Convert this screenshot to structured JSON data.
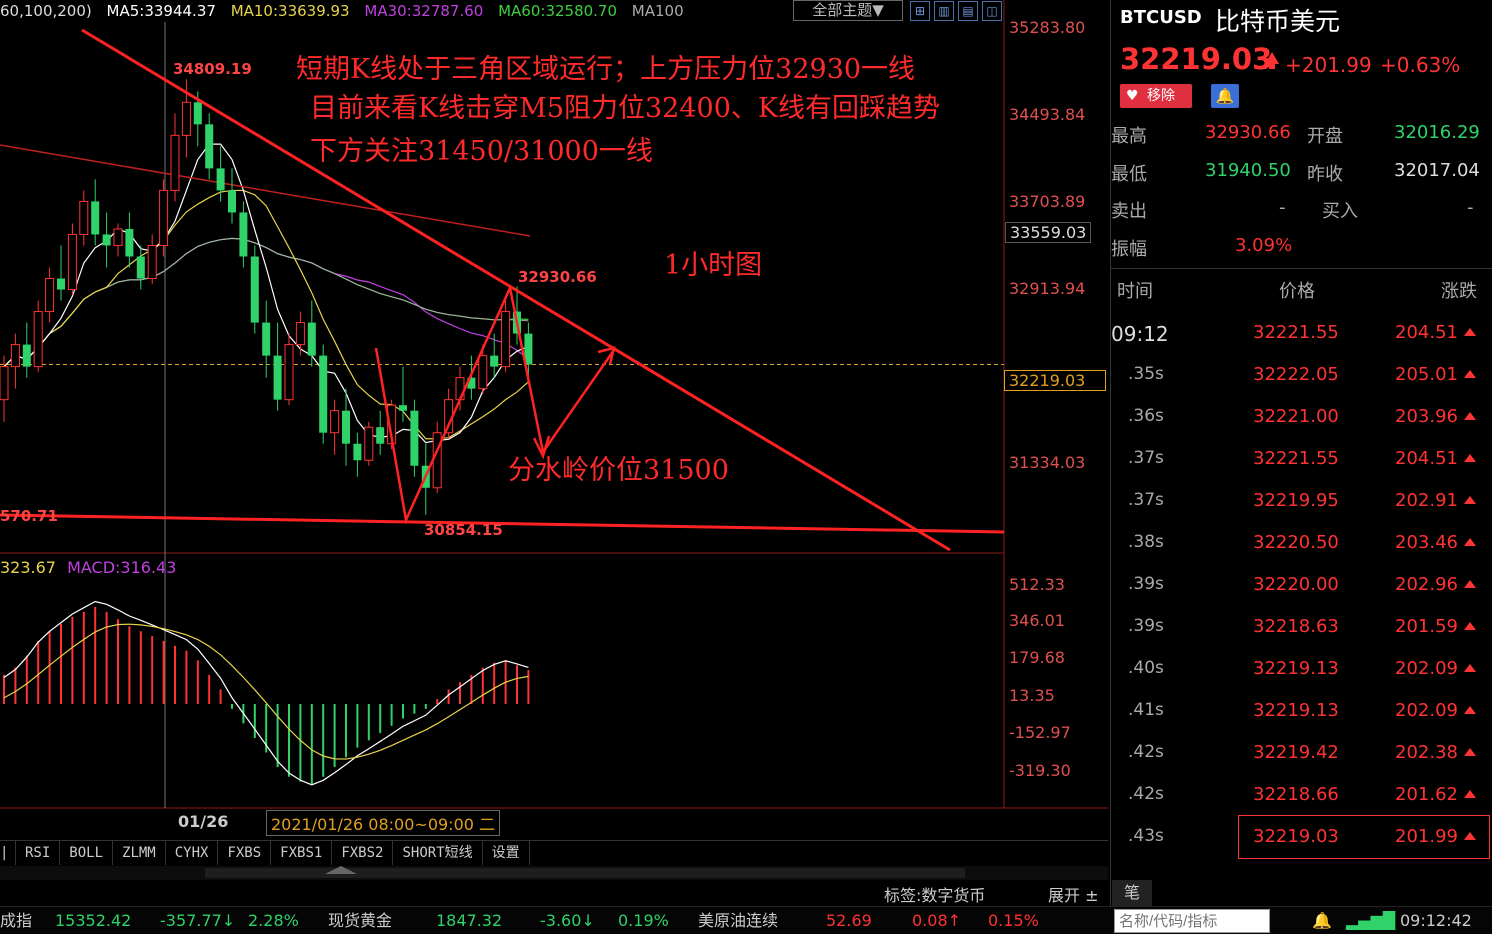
{
  "ma_header": {
    "prefix": "60,100,200)",
    "ma5": "MA5:33944.37",
    "ma10": "MA10:33639.93",
    "ma30": "MA30:32787.60",
    "ma60": "MA60:32580.70",
    "ma100": "MA100",
    "theme_button": "全部主题▼"
  },
  "price_axis": [
    "35283.80",
    "34493.84",
    "33703.89",
    "33559.03",
    "32913.94",
    "32219.03",
    "31334.03"
  ],
  "macd_axis": [
    "512.33",
    "346.01",
    "179.68",
    "13.35",
    "-152.97",
    "-319.30"
  ],
  "annotations": {
    "line1": "短期K线处于三角区域运行；上方压力位32930一线",
    "line2": "目前来看K线击穿M5阻力位32400、K线有回踩趋势",
    "line3": "下方关注31450/31000一线",
    "timeframe": "1小时图",
    "watershed": "分水岭价位31500"
  },
  "point_labels": {
    "high": "34809.19",
    "mid_high": "32930.66",
    "low": "30854.15",
    "left_cut": "570.71"
  },
  "macd_header": {
    "dif": "323.67",
    "macd": "MACD:316.43"
  },
  "time_axis": {
    "date": "01/26",
    "range": "2021/01/26 08:00~09:00 二"
  },
  "bottom_tabs": [
    "RSI",
    "BOLL",
    "ZLMM",
    "CYHX",
    "FXBS",
    "FXBS1",
    "FXBS2",
    "SHORT短线",
    "设置"
  ],
  "tag_bar": {
    "tag": "标签:数字货币",
    "expand": "展开 ±",
    "pen": "笔"
  },
  "ticker": {
    "label1": "成指",
    "v1": "15352.42",
    "c1": "-357.77↓",
    "p1": "2.28%",
    "label2": "现货黄金",
    "v2": "1847.32",
    "c2": "-3.60↓",
    "p2": "0.19%",
    "label3": "美原油连续",
    "v3": "52.69",
    "c3": "0.08↑",
    "p3": "0.15%",
    "search_placeholder": "名称/代码/指标",
    "clock": "09:12:42"
  },
  "quote": {
    "symbol": "BTCUSD",
    "name": "比特币美元",
    "price": "32219.03",
    "change": "+201.99",
    "change_pct": "+0.63%",
    "remove_btn": "移除",
    "high_label": "最高",
    "high": "32930.66",
    "open_label": "开盘",
    "open": "32016.29",
    "low_label": "最低",
    "low": "31940.50",
    "prev_label": "昨收",
    "prev": "32017.04",
    "sell_label": "卖出",
    "sell": "-",
    "buy_label": "买入",
    "buy": "-",
    "amp_label": "振幅",
    "amp": "3.09%"
  },
  "trades_header": {
    "time": "时间",
    "price": "价格",
    "change": "涨跌"
  },
  "trades": [
    {
      "time": "09:12",
      "price": "32221.55",
      "change": "204.51"
    },
    {
      "time": ".35s",
      "price": "32222.05",
      "change": "205.01"
    },
    {
      "time": ".36s",
      "price": "32221.00",
      "change": "203.96"
    },
    {
      "time": ".37s",
      "price": "32221.55",
      "change": "204.51"
    },
    {
      "time": ".37s",
      "price": "32219.95",
      "change": "202.91"
    },
    {
      "time": ".38s",
      "price": "32220.50",
      "change": "203.46"
    },
    {
      "time": ".39s",
      "price": "32220.00",
      "change": "202.96"
    },
    {
      "time": ".39s",
      "price": "32218.63",
      "change": "201.59"
    },
    {
      "time": ".40s",
      "price": "32219.13",
      "change": "202.09"
    },
    {
      "time": ".41s",
      "price": "32219.13",
      "change": "202.09"
    },
    {
      "time": ".42s",
      "price": "32219.42",
      "change": "202.38"
    },
    {
      "time": ".42s",
      "price": "32218.66",
      "change": "201.62"
    },
    {
      "time": ".43s",
      "price": "32219.03",
      "change": "201.99"
    }
  ],
  "colors": {
    "up": "#ff3333",
    "down": "#2fd36a",
    "annotation": "#ff2222",
    "ma5": "#ffffff",
    "ma10": "#e8d44a",
    "ma30": "#c040e0",
    "ma60": "#3fcf3f",
    "ma100": "#aaaaaa"
  },
  "candles": [
    [
      31900,
      32300,
      31700,
      32200
    ],
    [
      32200,
      32500,
      32000,
      32400
    ],
    [
      32400,
      32600,
      32100,
      32200
    ],
    [
      32200,
      32800,
      32150,
      32700
    ],
    [
      32700,
      33100,
      32600,
      33000
    ],
    [
      33000,
      33300,
      32800,
      32900
    ],
    [
      32900,
      33500,
      32850,
      33400
    ],
    [
      33400,
      33800,
      33300,
      33700
    ],
    [
      33700,
      33900,
      33300,
      33400
    ],
    [
      33400,
      33600,
      33100,
      33300
    ],
    [
      33300,
      33500,
      33200,
      33450
    ],
    [
      33450,
      33600,
      33100,
      33200
    ],
    [
      33200,
      33300,
      32900,
      33000
    ],
    [
      33000,
      33400,
      32950,
      33300
    ],
    [
      33300,
      33900,
      33200,
      33800
    ],
    [
      33800,
      34500,
      33700,
      34300
    ],
    [
      34300,
      34810,
      34100,
      34600
    ],
    [
      34600,
      34700,
      34200,
      34400
    ],
    [
      34400,
      34500,
      33900,
      34000
    ],
    [
      34000,
      34200,
      33700,
      33800
    ],
    [
      33800,
      34000,
      33500,
      33600
    ],
    [
      33600,
      33700,
      33100,
      33200
    ],
    [
      33200,
      33300,
      32500,
      32600
    ],
    [
      32600,
      32800,
      32100,
      32300
    ],
    [
      32300,
      32600,
      31800,
      31900
    ],
    [
      31900,
      32500,
      31850,
      32400
    ],
    [
      32400,
      32700,
      32300,
      32600
    ],
    [
      32600,
      32800,
      32200,
      32300
    ],
    [
      32300,
      32400,
      31500,
      31600
    ],
    [
      31600,
      31900,
      31400,
      31800
    ],
    [
      31800,
      32000,
      31300,
      31500
    ],
    [
      31500,
      31600,
      31200,
      31350
    ],
    [
      31350,
      31700,
      31300,
      31650
    ],
    [
      31650,
      31800,
      31400,
      31500
    ],
    [
      31500,
      31900,
      31450,
      31850
    ],
    [
      31850,
      32200,
      31700,
      31800
    ],
    [
      31800,
      31900,
      31200,
      31300
    ],
    [
      31300,
      31500,
      30854,
      31100
    ],
    [
      31100,
      31700,
      31050,
      31600
    ],
    [
      31600,
      32000,
      31550,
      31900
    ],
    [
      31900,
      32200,
      31800,
      32100
    ],
    [
      32100,
      32300,
      31900,
      32000
    ],
    [
      32000,
      32400,
      31950,
      32300
    ],
    [
      32300,
      32500,
      32100,
      32200
    ],
    [
      32200,
      32800,
      32150,
      32700
    ],
    [
      32700,
      32930,
      32400,
      32500
    ],
    [
      32500,
      32600,
      32100,
      32219
    ]
  ],
  "macd_hist": [
    120,
    150,
    200,
    260,
    300,
    330,
    360,
    380,
    400,
    380,
    350,
    320,
    300,
    280,
    260,
    240,
    220,
    180,
    120,
    60,
    -20,
    -80,
    -140,
    -200,
    -260,
    -300,
    -320,
    -330,
    -300,
    -260,
    -220,
    -180,
    -150,
    -120,
    -90,
    -60,
    -40,
    -20,
    20,
    60,
    90,
    120,
    150,
    170,
    180,
    160,
    140
  ]
}
